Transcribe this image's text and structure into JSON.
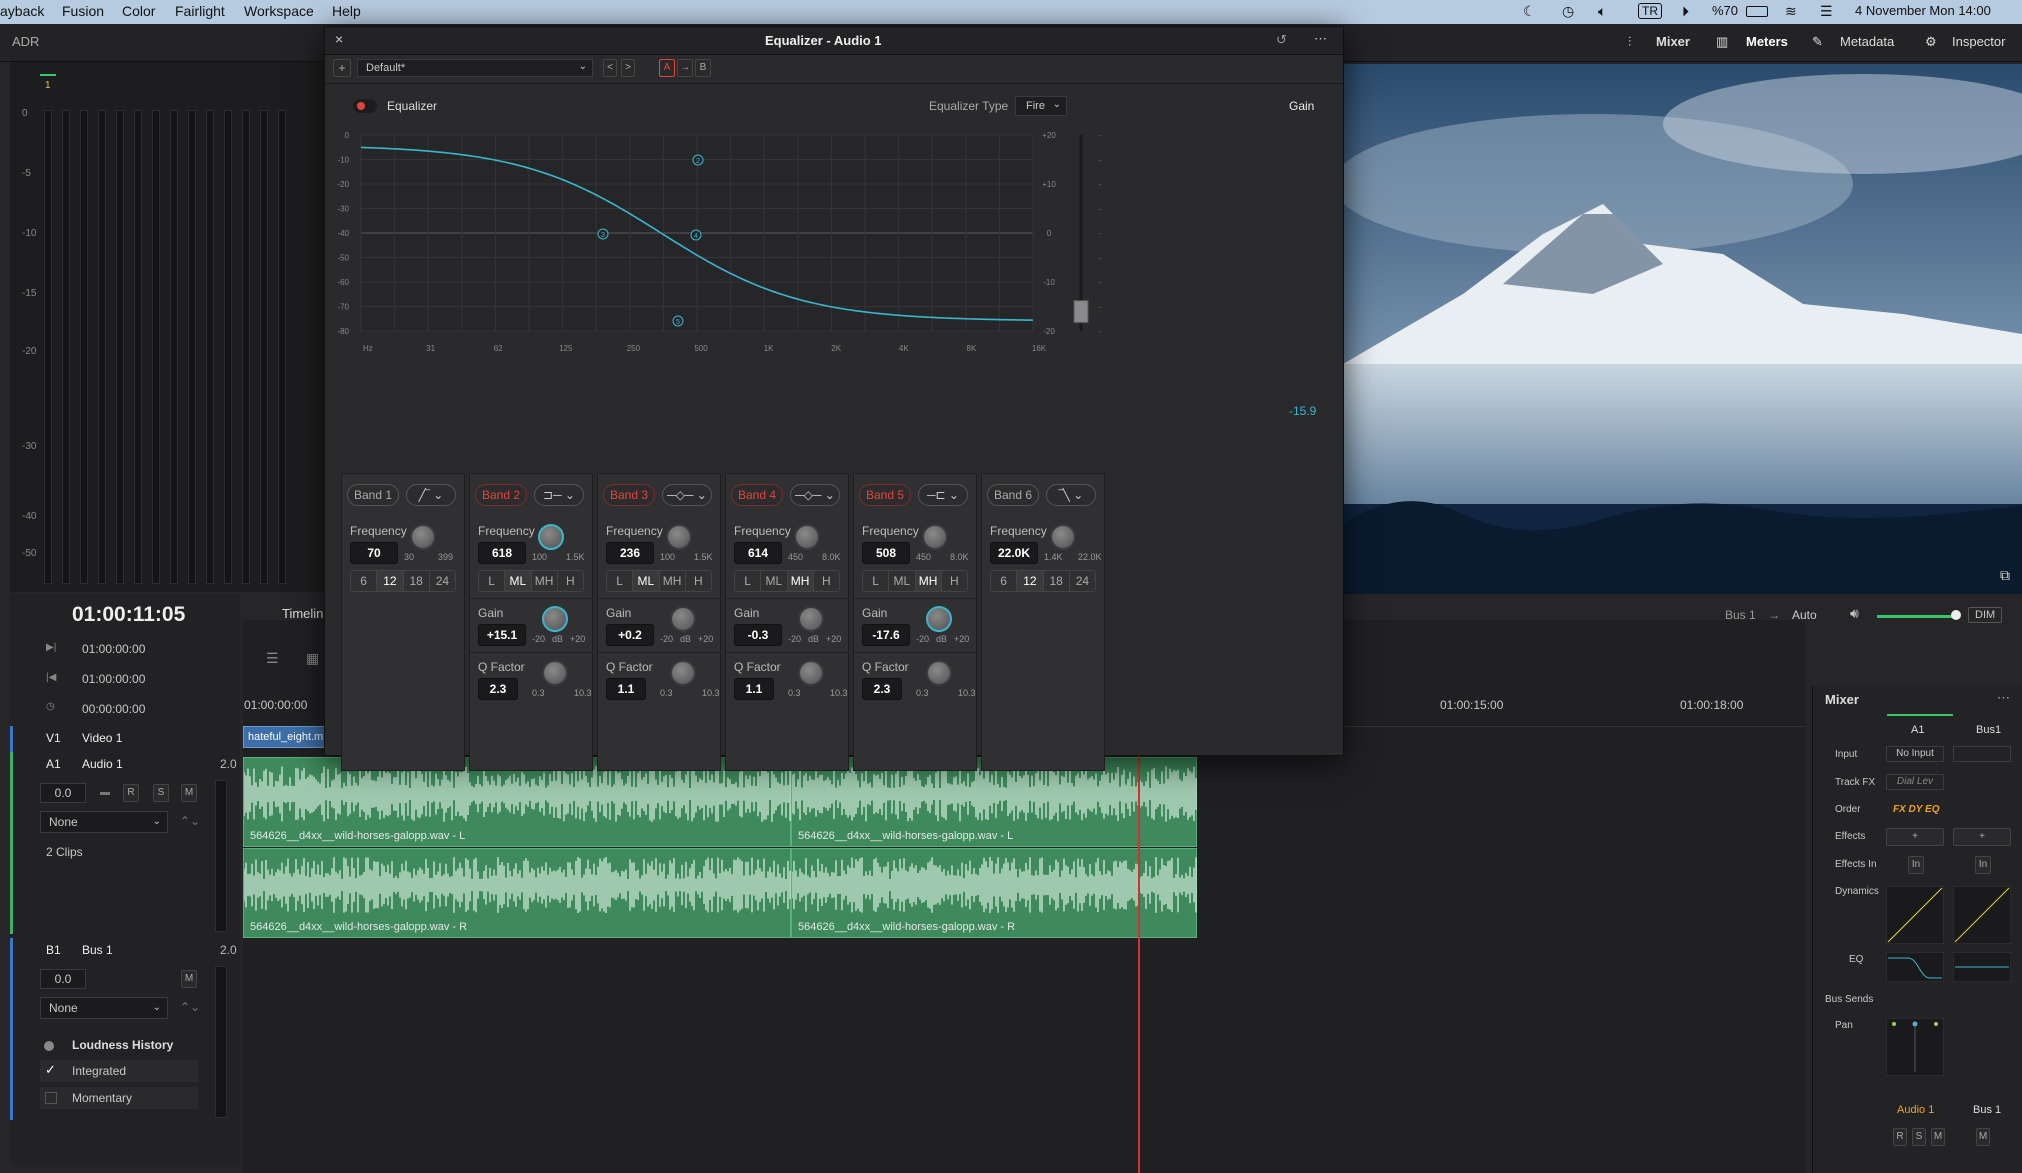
{
  "menubar": {
    "items": [
      "ayback",
      "Fusion",
      "Color",
      "Fairlight",
      "Workspace",
      "Help"
    ],
    "status": {
      "tr": "TR",
      "battery": "%70",
      "datetime": "4 November Mon  14:00"
    }
  },
  "topbar": {
    "left_label": "ADR",
    "mixer": "Mixer",
    "meters": "Meters",
    "metadata": "Metadata",
    "inspector": "Inspector",
    "meter_track": "1"
  },
  "meter_scale": [
    "0",
    "-5",
    "-10",
    "-15",
    "-20",
    "-30",
    "-40",
    "-50"
  ],
  "eq": {
    "title": "Equalizer - Audio 1",
    "preset": "Default*",
    "ab": {
      "a": "A",
      "arrow": "→",
      "b": "B"
    },
    "toggle_label": "Equalizer",
    "type_label": "Equalizer Type",
    "type_value": "Fire",
    "gain_label": "Gain",
    "gain_value": "-15.9",
    "db_left": [
      "0",
      "-10",
      "-20",
      "-30",
      "-40",
      "-50",
      "-60",
      "-70",
      "-80"
    ],
    "db_right": [
      "+20",
      "+10",
      "0",
      "-10",
      "-20"
    ],
    "slider_scale": [
      "-",
      "-",
      "-",
      "-",
      "-",
      "-",
      "-",
      "-",
      "-"
    ],
    "freq_ticks": [
      "Hz",
      "31",
      "62",
      "125",
      "250",
      "500",
      "1K",
      "2K",
      "4K",
      "8K",
      "16K"
    ],
    "nodes": [
      "2",
      "3",
      "4",
      "5"
    ],
    "bands": [
      {
        "name": "Band 1",
        "active": false,
        "shape": "╱‾",
        "freq_label": "Frequency",
        "freq": "70",
        "fmin": "30",
        "fmax": "399",
        "kind": "slope",
        "slopes": [
          "6",
          "12",
          "18",
          "24"
        ],
        "sel": "12"
      },
      {
        "name": "Band 2",
        "active": true,
        "shape": "⊐─",
        "freq_label": "Frequency",
        "freq": "618",
        "fmin": "100",
        "fmax": "1.5K",
        "kind": "full",
        "types": [
          "L",
          "ML",
          "MH",
          "H"
        ],
        "sel": "ML",
        "gain_label": "Gain",
        "gain": "+15.1",
        "gmin": "-20",
        "gunit": "dB",
        "gmax": "+20",
        "q_label": "Q Factor",
        "q": "2.3",
        "qmin": "0.3",
        "qmax": "10.3"
      },
      {
        "name": "Band 3",
        "active": true,
        "shape": "─◇─",
        "freq_label": "Frequency",
        "freq": "236",
        "fmin": "100",
        "fmax": "1.5K",
        "kind": "full",
        "types": [
          "L",
          "ML",
          "MH",
          "H"
        ],
        "sel": "ML",
        "gain_label": "Gain",
        "gain": "+0.2",
        "gmin": "-20",
        "gunit": "dB",
        "gmax": "+20",
        "q_label": "Q Factor",
        "q": "1.1",
        "qmin": "0.3",
        "qmax": "10.3"
      },
      {
        "name": "Band 4",
        "active": true,
        "shape": "─◇─",
        "freq_label": "Frequency",
        "freq": "614",
        "fmin": "450",
        "fmax": "8.0K",
        "kind": "full",
        "types": [
          "L",
          "ML",
          "MH",
          "H"
        ],
        "sel": "MH",
        "gain_label": "Gain",
        "gain": "-0.3",
        "gmin": "-20",
        "gunit": "dB",
        "gmax": "+20",
        "q_label": "Q Factor",
        "q": "1.1",
        "qmin": "0.3",
        "qmax": "10.3"
      },
      {
        "name": "Band 5",
        "active": true,
        "shape": "─⊏",
        "freq_label": "Frequency",
        "freq": "508",
        "fmin": "450",
        "fmax": "8.0K",
        "kind": "full",
        "types": [
          "L",
          "ML",
          "MH",
          "H"
        ],
        "sel": "MH",
        "gain_label": "Gain",
        "gain": "-17.6",
        "gmin": "-20",
        "gunit": "dB",
        "gmax": "+20",
        "q_label": "Q Factor",
        "q": "2.3",
        "qmin": "0.3",
        "qmax": "10.3"
      },
      {
        "name": "Band 6",
        "active": false,
        "shape": "‾╲",
        "freq_label": "Frequency",
        "freq": "22.0K",
        "fmin": "1.4K",
        "fmax": "22.0K",
        "kind": "slope",
        "slopes": [
          "6",
          "12",
          "18",
          "24"
        ],
        "sel": "12"
      }
    ]
  },
  "transport": {
    "timecode": "01:00:11:05",
    "timeline_label": "Timelin",
    "tc_rows": [
      "01:00:00:00",
      "01:00:00:00",
      "00:00:00:00"
    ]
  },
  "tracks": {
    "v1": {
      "id": "V1",
      "name": "Video 1",
      "clip": "hateful_eight.m"
    },
    "a1": {
      "id": "A1",
      "name": "Audio 1",
      "ch": "2.0",
      "level": "0.0",
      "r": "R",
      "s": "S",
      "m": "M",
      "select": "None",
      "clips": "2 Clips",
      "clip_names": [
        "564626__d4xx__wild-horses-galopp.wav - L",
        "564626__d4xx__wild-horses-galopp.wav - L",
        "564626__d4xx__wild-horses-galopp.wav - R",
        "564626__d4xx__wild-horses-galopp.wav - R"
      ]
    },
    "b1": {
      "id": "B1",
      "name": "Bus 1",
      "ch": "2.0",
      "level": "0.0",
      "m": "M",
      "select": "None"
    }
  },
  "loudness": {
    "title": "Loudness History",
    "integrated": "Integrated",
    "momentary": "Momentary"
  },
  "ruler": {
    "t0": "01:00:00:00",
    "t1": "01:00:15:00",
    "t2": "01:00:18:00"
  },
  "monitor": {
    "bus": "Bus 1",
    "auto": "Auto",
    "dim": "DIM",
    "arrow": "→",
    "nav": "<·>"
  },
  "mixer": {
    "title": "Mixer",
    "cols": [
      "A1",
      "Bus1"
    ],
    "rows": [
      "Input",
      "Track FX",
      "Order",
      "Effects",
      "Effects In",
      "Dynamics",
      "EQ",
      "Bus Sends",
      "Pan"
    ],
    "input_val": "No Input",
    "trackfx_val": "Dial Lev",
    "order_val": "FX DY EQ",
    "plus": "+",
    "in": "In",
    "names": [
      "Audio 1",
      "Bus 1"
    ],
    "r": "R",
    "s": "S",
    "m": "M"
  },
  "colors": {
    "accent": "#39b7cf",
    "red": "#e0453a",
    "clip": "#3e8a5c",
    "orange": "#f0a21f"
  }
}
